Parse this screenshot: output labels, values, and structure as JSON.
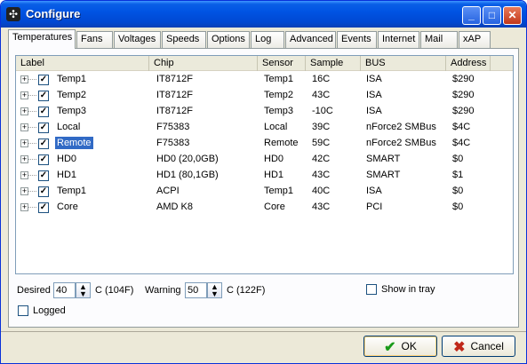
{
  "window": {
    "title": "Configure",
    "icon": "app-gear-icon",
    "controls": {
      "minimize": "_",
      "maximize": "□",
      "close": "✕"
    }
  },
  "tabs": [
    {
      "label": "Temperatures",
      "active": true
    },
    {
      "label": "Fans"
    },
    {
      "label": "Voltages"
    },
    {
      "label": "Speeds"
    },
    {
      "label": "Options"
    },
    {
      "label": "Log"
    },
    {
      "label": "Advanced"
    },
    {
      "label": "Events"
    },
    {
      "label": "Internet"
    },
    {
      "label": "Mail"
    },
    {
      "label": "xAP"
    }
  ],
  "table": {
    "columns": [
      "Label",
      "Chip",
      "Sensor",
      "Sample",
      "BUS",
      "Address"
    ],
    "rows": [
      {
        "label": "Temp1",
        "chip": "IT8712F",
        "sensor": "Temp1",
        "sample": "16C",
        "bus": "ISA",
        "address": "$290",
        "checked": true
      },
      {
        "label": "Temp2",
        "chip": "IT8712F",
        "sensor": "Temp2",
        "sample": "43C",
        "bus": "ISA",
        "address": "$290",
        "checked": true
      },
      {
        "label": "Temp3",
        "chip": "IT8712F",
        "sensor": "Temp3",
        "sample": "-10C",
        "bus": "ISA",
        "address": "$290",
        "checked": true
      },
      {
        "label": "Local",
        "chip": "F75383",
        "sensor": "Local",
        "sample": "39C",
        "bus": "nForce2 SMBus",
        "address": "$4C",
        "checked": true
      },
      {
        "label": "Remote",
        "chip": "F75383",
        "sensor": "Remote",
        "sample": "59C",
        "bus": "nForce2 SMBus",
        "address": "$4C",
        "checked": true,
        "selected": true
      },
      {
        "label": "HD0",
        "chip": "HD0 (20,0GB)",
        "sensor": "HD0",
        "sample": "42C",
        "bus": "SMART",
        "address": "$0",
        "checked": true
      },
      {
        "label": "HD1",
        "chip": "HD1 (80,1GB)",
        "sensor": "HD1",
        "sample": "43C",
        "bus": "SMART",
        "address": "$1",
        "checked": true
      },
      {
        "label": "Temp1",
        "chip": "ACPI",
        "sensor": "Temp1",
        "sample": "40C",
        "bus": "ISA",
        "address": "$0",
        "checked": true
      },
      {
        "label": "Core",
        "chip": "AMD K8",
        "sensor": "Core",
        "sample": "43C",
        "bus": "PCI",
        "address": "$0",
        "checked": true
      }
    ]
  },
  "settings": {
    "desired_label": "Desired",
    "desired_value": "40",
    "desired_unit": "C (104F)",
    "warning_label": "Warning",
    "warning_value": "50",
    "warning_unit": "C (122F)",
    "show_in_tray_label": "Show in tray",
    "show_in_tray_checked": false,
    "logged_label": "Logged",
    "logged_checked": false
  },
  "buttons": {
    "ok_label": "OK",
    "cancel_label": "Cancel"
  },
  "colors": {
    "titlebar": "#0054e3",
    "selection": "#316ac5",
    "window_bg": "#ece9d8"
  }
}
